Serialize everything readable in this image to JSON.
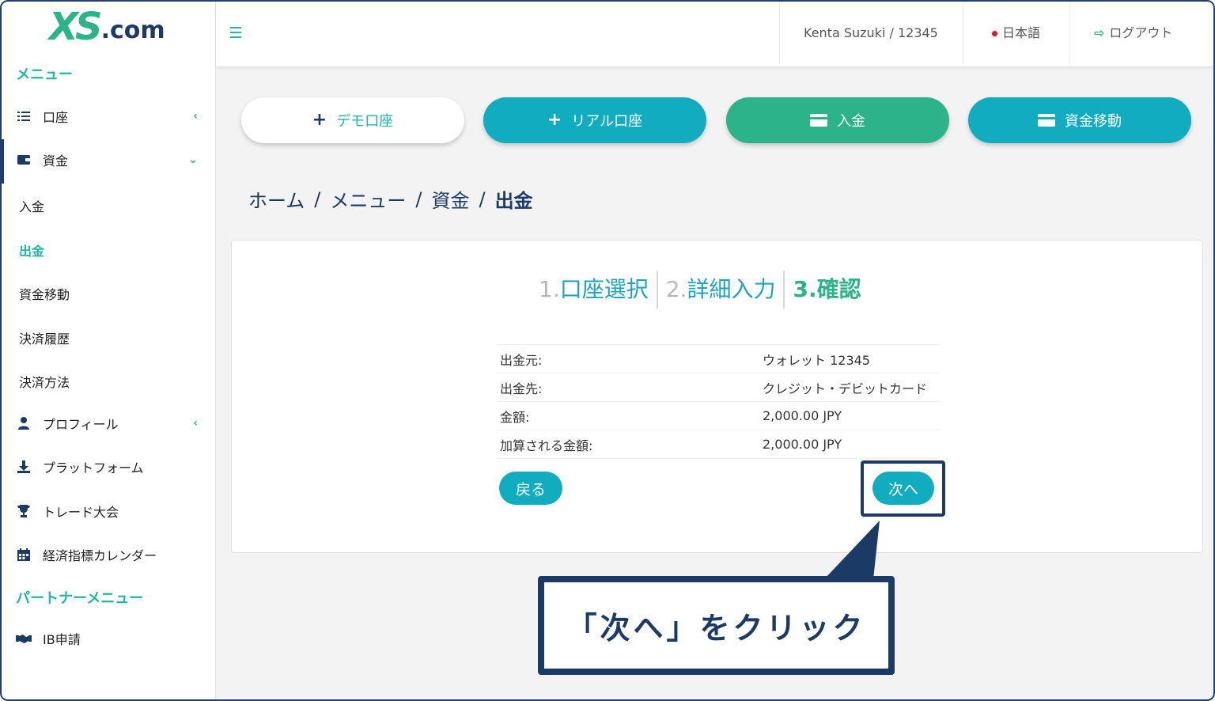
{
  "logo": {
    "xs": "XS",
    "com": ".com"
  },
  "sidebar": {
    "menu_heading": "メニュー",
    "items": [
      {
        "label": "口座",
        "icon": "list-icon",
        "chevron": "‹"
      },
      {
        "label": "資金",
        "icon": "wallet-icon",
        "chevron": "⌄"
      }
    ],
    "sub_items": [
      {
        "label": "入金"
      },
      {
        "label": "出金"
      },
      {
        "label": "資金移動"
      },
      {
        "label": "決済履歴"
      },
      {
        "label": "決済方法"
      }
    ],
    "more_items": [
      {
        "label": "プロフィール",
        "icon": "user-icon",
        "chevron": "‹"
      },
      {
        "label": "プラットフォーム",
        "icon": "download-icon"
      },
      {
        "label": "トレード大会",
        "icon": "trophy-icon"
      },
      {
        "label": "経済指標カレンダー",
        "icon": "calendar-icon"
      }
    ],
    "partner_heading": "パートナーメニュー",
    "partner_items": [
      {
        "label": "IB申請",
        "icon": "handshake-icon"
      }
    ]
  },
  "topbar": {
    "user": "Kenta Suzuki / 12345",
    "language": "日本語",
    "logout": "ログアウト"
  },
  "actions": {
    "demo": "デモ口座",
    "real": "リアル口座",
    "deposit": "入金",
    "transfer": "資金移動"
  },
  "breadcrumb": [
    "ホーム",
    "メニュー",
    "資金",
    "出金"
  ],
  "steps": [
    {
      "num": "1.",
      "label": "口座選択"
    },
    {
      "num": "2.",
      "label": "詳細入力"
    },
    {
      "num": "3.",
      "label": "確認"
    }
  ],
  "details": [
    {
      "key": "出金元:",
      "value": "ウォレット 12345"
    },
    {
      "key": "出金先:",
      "value": "クレジット・デビットカード"
    },
    {
      "key": "金額:",
      "value": "2,000.00 JPY"
    },
    {
      "key": "加算される金額:",
      "value": "2,000.00 JPY"
    }
  ],
  "buttons": {
    "back": "戻る",
    "next": "次へ"
  },
  "callout": "「次へ」をクリック",
  "colors": {
    "teal": "#12acc1",
    "green": "#2cb38a",
    "navy": "#1b3a66",
    "accent": "#1fb8a3"
  }
}
